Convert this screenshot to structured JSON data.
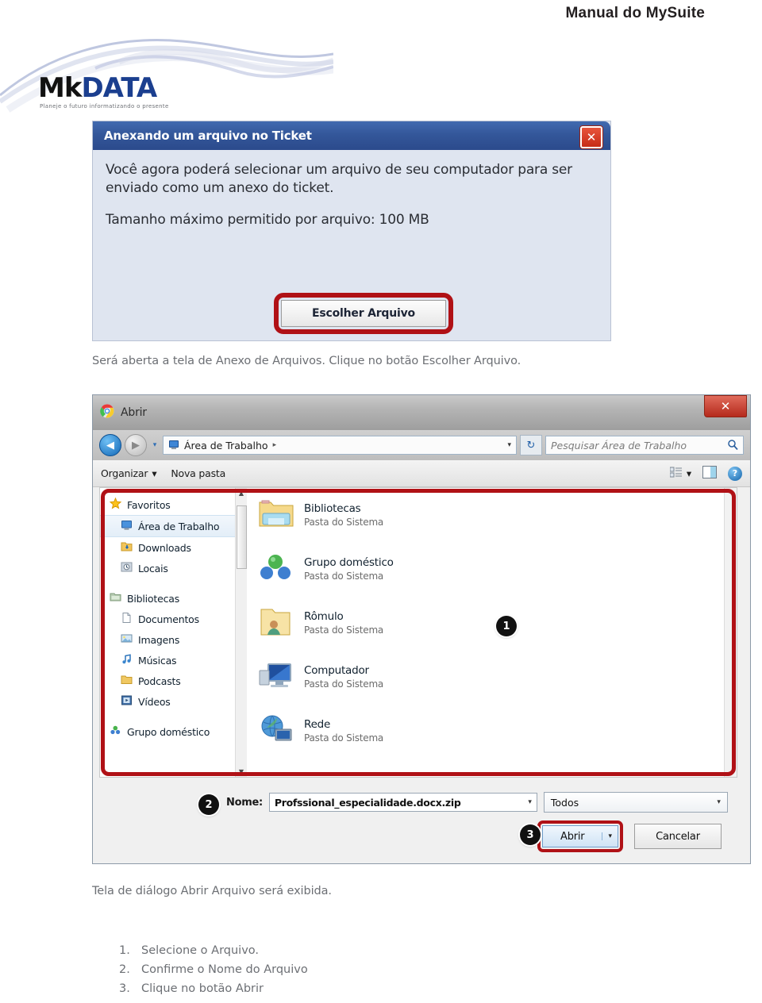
{
  "page": {
    "header_title": "Manual do MySuite"
  },
  "logo": {
    "name_part1": "Mk",
    "name_part2": "DATA",
    "tagline": "Planeje o futuro informatizando o presente"
  },
  "attach_dialog": {
    "title": "Anexando um arquivo no Ticket",
    "close_label": "✕",
    "paragraph1": "Você agora poderá selecionar um arquivo de seu computador para ser enviado como um anexo do ticket.",
    "paragraph2": "Tamanho máximo permitido por arquivo: 100 MB",
    "button_label": "Escolher Arquivo",
    "highlight_color": "#b01116",
    "header_color": "#2e5496",
    "body_color": "#dfe5f0"
  },
  "caption1": "Será aberta a tela de Anexo de Arquivos. Clique no botão Escolher Arquivo.",
  "caption2": "Tela de diálogo Abrir Arquivo será exibida.",
  "steps": [
    {
      "num": "1.",
      "text": "Selecione o Arquivo."
    },
    {
      "num": "2.",
      "text": "Confirme o Nome do Arquivo"
    },
    {
      "num": "3.",
      "text": "Clique no botão Abrir"
    }
  ],
  "file_dialog": {
    "title": "Abrir",
    "close_label": "✕",
    "nav": {
      "back_glyph": "◀",
      "forward_glyph": "▶",
      "history_glyph": "▾"
    },
    "address": {
      "value": "Área de Trabalho",
      "separator": "▸",
      "caret": "▾"
    },
    "refresh_glyph": "↻",
    "search": {
      "placeholder": "Pesquisar Área de Trabalho",
      "icon": "search-icon"
    },
    "toolbar": {
      "organize_label": "Organizar",
      "organize_caret": "▾",
      "new_folder_label": "Nova pasta",
      "view_caret": "▾",
      "help_label": "?"
    },
    "sidebar": [
      {
        "label": "Favoritos",
        "icon": "star-icon",
        "indent": false,
        "selected": false
      },
      {
        "label": "Área de Trabalho",
        "icon": "desktop-icon",
        "indent": true,
        "selected": true
      },
      {
        "label": "Downloads",
        "icon": "downloads-folder-icon",
        "indent": true,
        "selected": false
      },
      {
        "label": "Locais",
        "icon": "recent-places-icon",
        "indent": true,
        "selected": false
      },
      {
        "label": "Bibliotecas",
        "icon": "libraries-icon",
        "indent": false,
        "selected": false
      },
      {
        "label": "Documentos",
        "icon": "documents-icon",
        "indent": true,
        "selected": false
      },
      {
        "label": "Imagens",
        "icon": "pictures-icon",
        "indent": true,
        "selected": false
      },
      {
        "label": "Músicas",
        "icon": "music-icon",
        "indent": true,
        "selected": false
      },
      {
        "label": "Podcasts",
        "icon": "podcasts-folder-icon",
        "indent": true,
        "selected": false
      },
      {
        "label": "Vídeos",
        "icon": "videos-icon",
        "indent": true,
        "selected": false
      },
      {
        "label": "Grupo doméstico",
        "icon": "homegroup-icon",
        "indent": false,
        "selected": false
      }
    ],
    "files": [
      {
        "name": "Bibliotecas",
        "type": "Pasta do Sistema",
        "icon": "libraries-folder-icon"
      },
      {
        "name": "Grupo doméstico",
        "type": "Pasta do Sistema",
        "icon": "homegroup-icon"
      },
      {
        "name": "Rômulo",
        "type": "Pasta do Sistema",
        "icon": "user-folder-icon"
      },
      {
        "name": "Computador",
        "type": "Pasta do Sistema",
        "icon": "computer-icon"
      },
      {
        "name": "Rede",
        "type": "Pasta do Sistema",
        "icon": "network-icon"
      }
    ],
    "name_label": "Nome:",
    "name_value": "Profssional_especialidade.docx.zip",
    "name_caret": "▾",
    "filter_value": "Todos",
    "filter_caret": "▾",
    "open_label": "Abrir",
    "open_split_caret": "▾",
    "cancel_label": "Cancelar",
    "badges": {
      "one": "1",
      "two": "2",
      "three": "3"
    }
  }
}
